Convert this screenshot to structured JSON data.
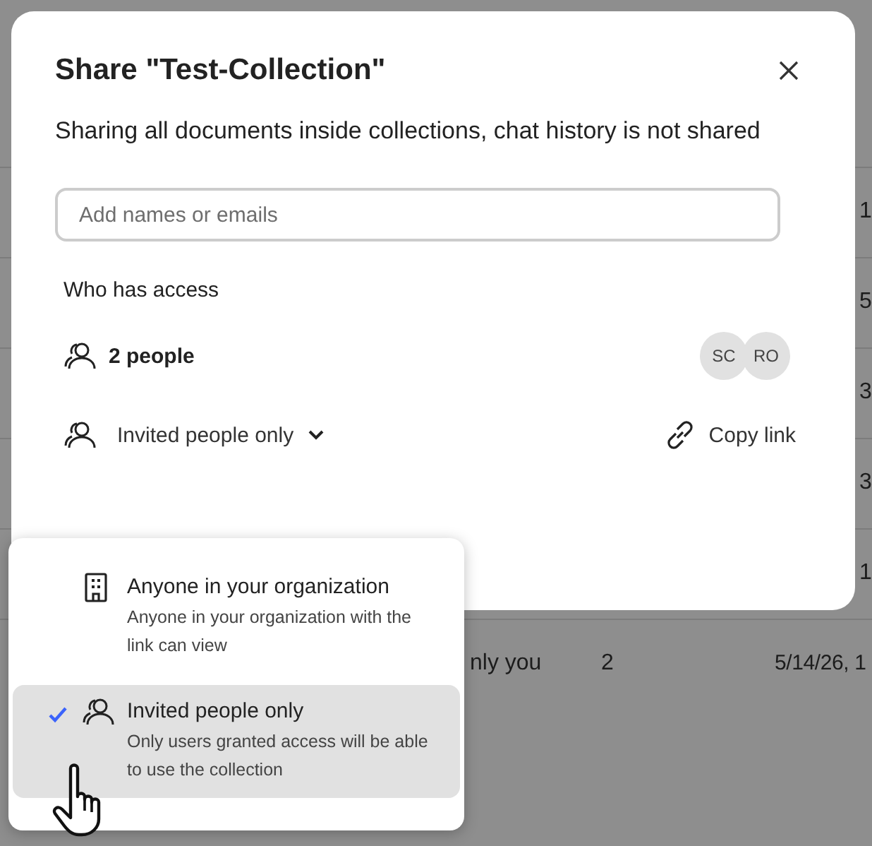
{
  "background_table": {
    "rows": [
      {
        "kind": "peek",
        "column_4": "1"
      },
      {
        "kind": "peek",
        "column_4": "5"
      },
      {
        "kind": "peek",
        "column_4": "3"
      },
      {
        "kind": "peek",
        "column_4": "3"
      },
      {
        "kind": "peek",
        "column_4": "1"
      },
      {
        "kind": "full",
        "column_2": "nly you",
        "column_3": "2",
        "column_4": "5/14/26, 1"
      }
    ]
  },
  "dialog": {
    "title": "Share \"Test-Collection\"",
    "description": "Sharing all documents inside collections, chat history is not shared",
    "search": {
      "placeholder": "Add names or emails"
    },
    "access_heading": "Who has access",
    "people": {
      "label": "2 people",
      "avatars": [
        "SC",
        "RO"
      ]
    },
    "access_dropdown": {
      "label": "Invited people only",
      "expanded": true
    },
    "copy_link": "Copy link"
  },
  "menu": {
    "items": [
      {
        "kind": "building",
        "title": "Anyone in your organization",
        "description": "Anyone in your organization with the link can view",
        "selected": false
      },
      {
        "kind": "people",
        "title": "Invited people only",
        "description": "Only users granted access will be able to use the collection",
        "selected": true
      }
    ]
  }
}
